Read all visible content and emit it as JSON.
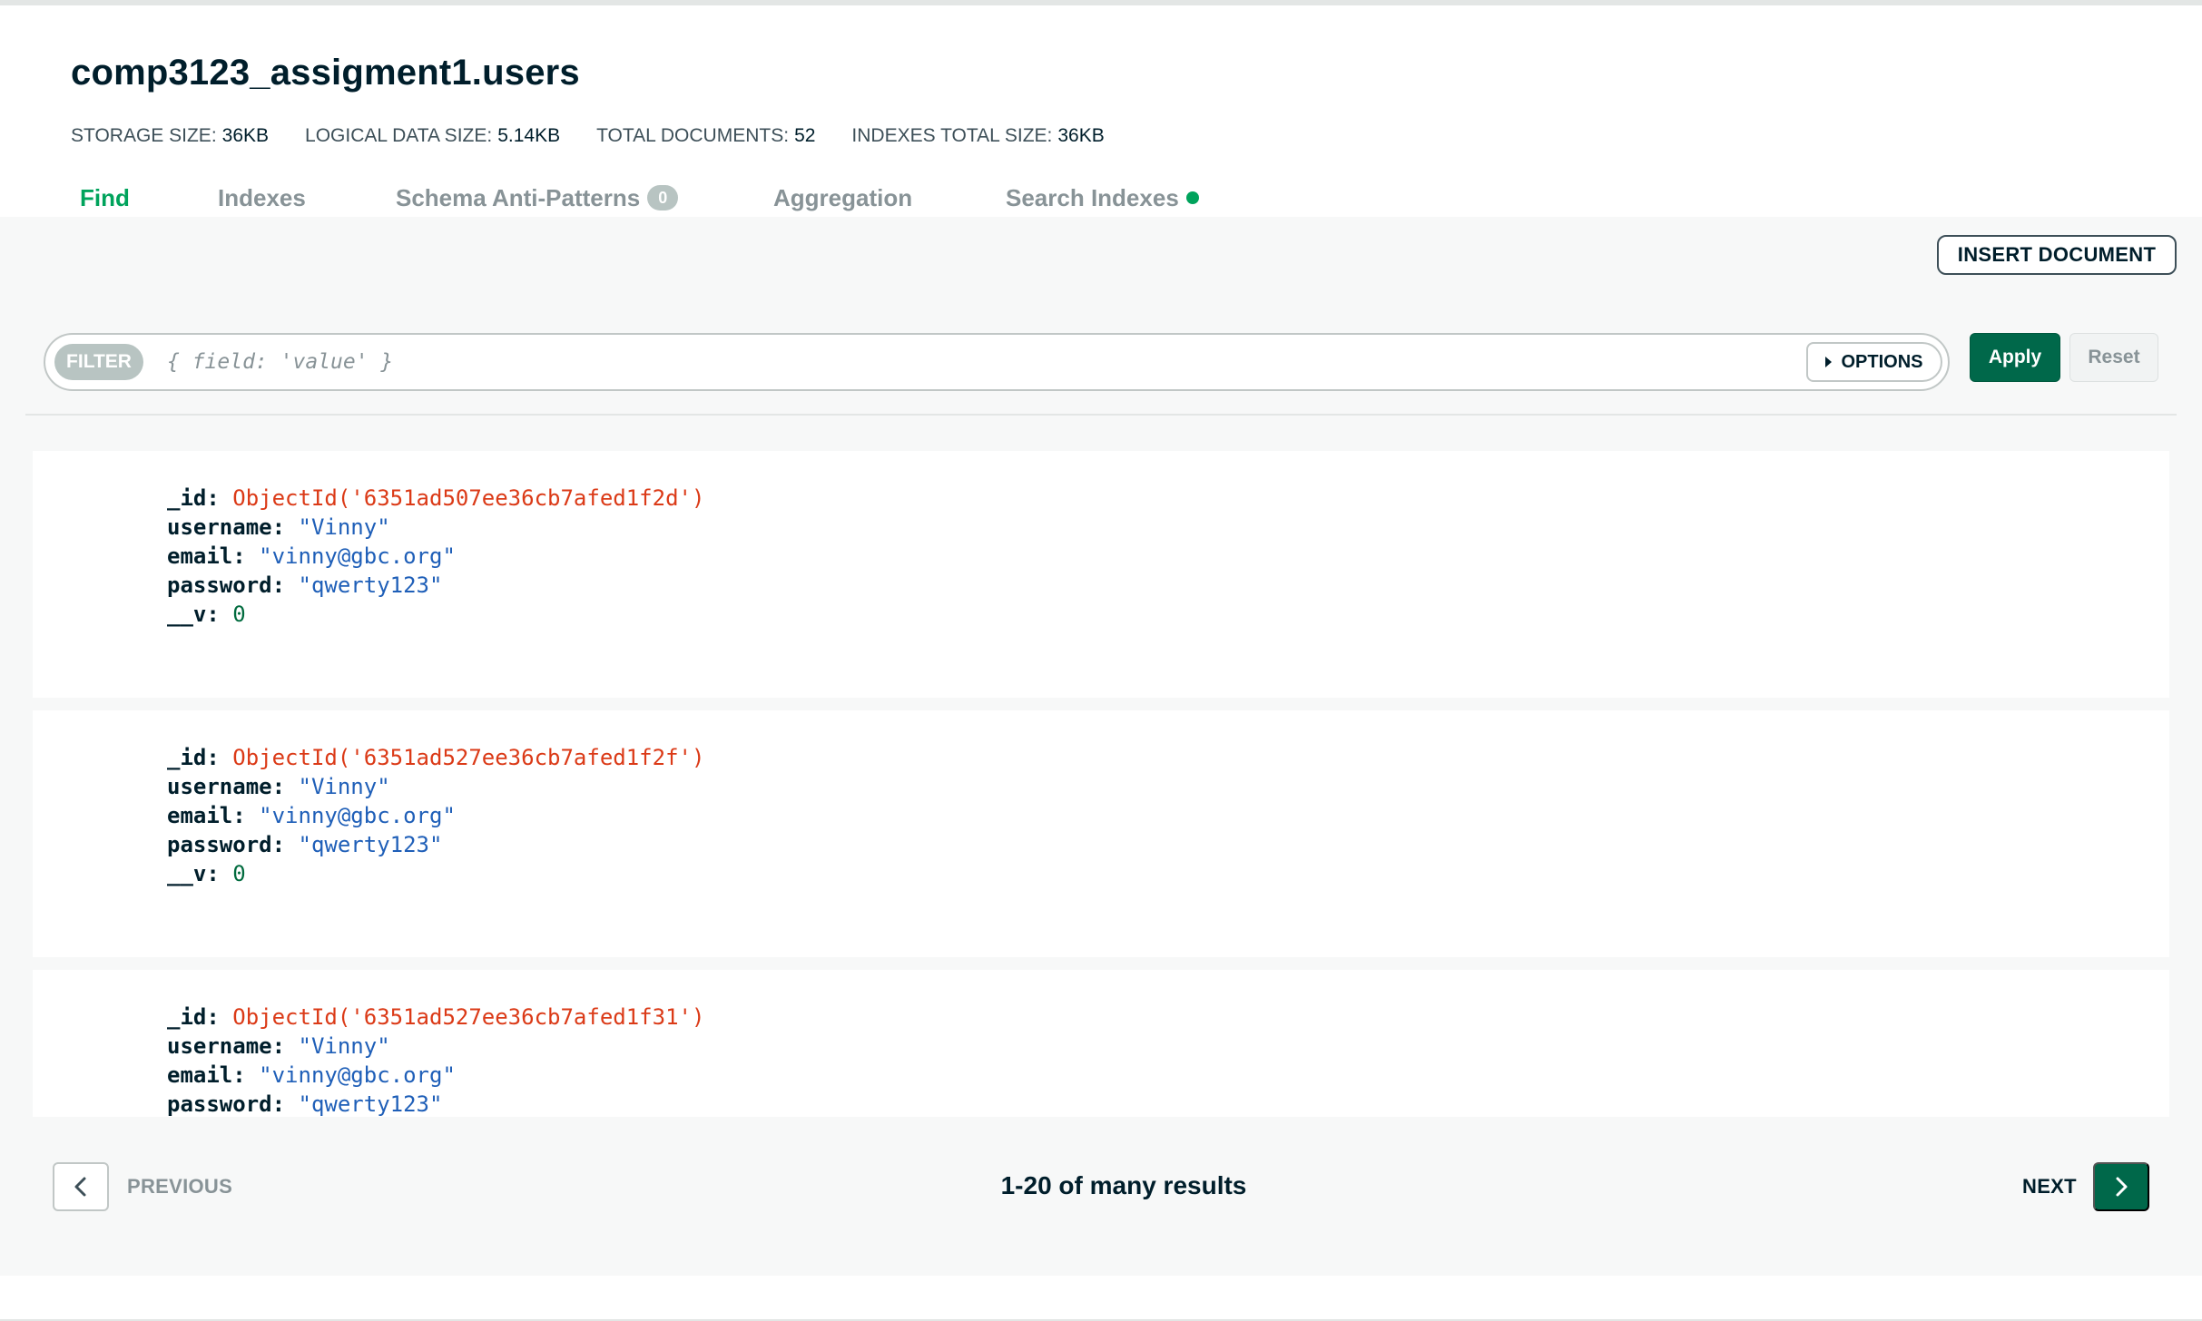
{
  "collection": {
    "title": "comp3123_assigment1.users",
    "stats": [
      {
        "label": "STORAGE SIZE:",
        "value": "36KB"
      },
      {
        "label": "LOGICAL DATA SIZE:",
        "value": "5.14KB"
      },
      {
        "label": "TOTAL DOCUMENTS:",
        "value": "52"
      },
      {
        "label": "INDEXES TOTAL SIZE:",
        "value": "36KB"
      }
    ]
  },
  "tabs": [
    {
      "label": "Find",
      "active": true
    },
    {
      "label": "Indexes"
    },
    {
      "label": "Schema Anti-Patterns",
      "count": "0"
    },
    {
      "label": "Aggregation"
    },
    {
      "label": "Search Indexes"
    }
  ],
  "toolbar": {
    "insert_label": "INSERT DOCUMENT",
    "filter_label": "FILTER",
    "filter_placeholder": "{ field: 'value' }",
    "options_label": "OPTIONS",
    "apply_label": "Apply",
    "reset_label": "Reset"
  },
  "documents": [
    {
      "id_key": "_id:",
      "id_value": "ObjectId('6351ad507ee36cb7afed1f2d')",
      "username_key": "username:",
      "username_value": "\"Vinny\"",
      "email_key": "email:",
      "email_value": "\"vinny@gbc.org\"",
      "password_key": "password:",
      "password_value": "\"qwerty123\"",
      "v_key": "__v:",
      "v_value": "0"
    },
    {
      "id_key": "_id:",
      "id_value": "ObjectId('6351ad527ee36cb7afed1f2f')",
      "username_key": "username:",
      "username_value": "\"Vinny\"",
      "email_key": "email:",
      "email_value": "\"vinny@gbc.org\"",
      "password_key": "password:",
      "password_value": "\"qwerty123\"",
      "v_key": "__v:",
      "v_value": "0"
    },
    {
      "id_key": "_id:",
      "id_value": "ObjectId('6351ad527ee36cb7afed1f31')",
      "username_key": "username:",
      "username_value": "\"Vinny\"",
      "email_key": "email:",
      "email_value": "\"vinny@gbc.org\"",
      "password_key": "password:",
      "password_value": "\"qwerty123\""
    }
  ],
  "pagination": {
    "previous_label": "PREVIOUS",
    "results_text": "1-20 of many results",
    "next_label": "NEXT"
  },
  "colors": {
    "accent_green": "#00684a",
    "active_tab": "#00a35c",
    "object_id": "#db3a17",
    "string_value": "#1f5fb8"
  },
  "icons": {
    "previous": "chevron-left-icon",
    "next": "chevron-right-icon",
    "options": "caret-right-icon",
    "search_indexes_status": "status-dot-icon"
  }
}
